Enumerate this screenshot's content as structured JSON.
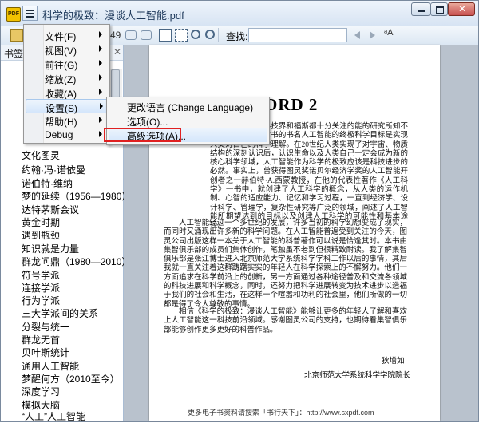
{
  "window": {
    "title": "科学的极致：漫谈人工智能.pdf",
    "app_icon_text": "PDF"
  },
  "toolbar": {
    "page_number": "49",
    "find_label": "查找:",
    "find_value": ""
  },
  "sidebar": {
    "title": "书签",
    "items": [
      "文化图灵",
      "约翰·冯·诺依曼",
      "诺伯特·维纳",
      "梦的延续（1956—1980）",
      "达特茅斯会议",
      "黄金时期",
      "遇到瓶颈",
      "知识就是力量",
      "群龙问鼎（1980—2010）",
      "符号学派",
      "连接学派",
      "行为学派",
      "三大学派间的关系",
      "分裂与统一",
      "群龙无首",
      "贝叶斯统计",
      "通用人工智能",
      "梦醒何方（2010至今）",
      "深度学习",
      "模拟大脑",
      "“人工”人工智能"
    ]
  },
  "menu": {
    "items": [
      {
        "label": "文件(F)"
      },
      {
        "label": "视图(V)"
      },
      {
        "label": "前往(G)"
      },
      {
        "label": "缩放(Z)"
      },
      {
        "label": "收藏(A)"
      },
      {
        "label": "设置(S)"
      },
      {
        "label": "帮助(H)"
      },
      {
        "label": "Debug"
      }
    ],
    "highlighted": "设置(S)"
  },
  "submenu": {
    "items": [
      {
        "label": "更改语言 (Change Language)"
      },
      {
        "label": "选项(O)..."
      },
      {
        "label": "高级选项(A)..."
      }
    ],
    "highlighted": "高级选项(A)..."
  },
  "document": {
    "heading": "WORD 2",
    "paragraph1": "展迅速，已成为科技界和福斯都十分关注的能的研究所知不深，但我很欣赏本书的书名人工智能的终极科学目标是实现人类对自己的科学理解。在20世纪人类实现了对宇宙、物质结构的深刻认识后，认识生命以及人类自己一定会成为新的核心科学领域，人工智能作为科学的极致应该是科技进步的必然。事实上，曾获得图灵奖诺贝尔经济学奖的人工智能开创者之一赫伯特·A.西蒙教授，在他的代表性著作《人工科学》一书中，就创建了人工科学的概念，从人类的运作机制、心智的适应能力、记忆和学习过程，一直到经济学、设计科学、管理学，复杂性研究等广泛的领域，阐述了人工智能所期望达到的目标以及创建人工科学的可能性和基本途径。",
    "paragraph2": "人工智能经过一个多世纪的发展，许多当初的科学幻想变成了现实，而同时又涌现出许多新的科学问题。在人工智能普遍受到关注的今天，图灵公司出版这样一本关于人工智能的科普著作可以说是恰逢其时。本书由集智俱乐部的成员们集体创作，笔触虽不老到但很精致耐读。我了解集智俱乐部是张江博士进入北京师范大学系统科学学科工作以后的事情，其后我就一直关注着这群踌躇实实的年轻人在科学探索上的不懈努力。他们一方面追求在科学前沿上的创新，另一方面通过各种途径普及和交流各领域的科技进展和科学概念，同时，还努力把科学进展转变为技术进步以造福于我们的社会和生活，在这样一个喧嚣和功利的社会里，他们所做的一切都是得了令人尊敬的事情。",
    "paragraph3": "相信《科学的极致：漫谈人工智能》能够让更多的年轻人了解和喜欢上人工智能这一科技前沿领域。感谢图灵公司的支持，也期待看集智俱乐部能够创作更多更好的科普作品。",
    "signature_name": "狄增如",
    "signature_title": "北京师范大学系统科学学院院长",
    "footer": "更多电子书资料请搜索「书行天下」：http://www.sxpdf.com"
  },
  "colors": {
    "highlight_box": "#e02020",
    "accent": "#1e395b"
  }
}
